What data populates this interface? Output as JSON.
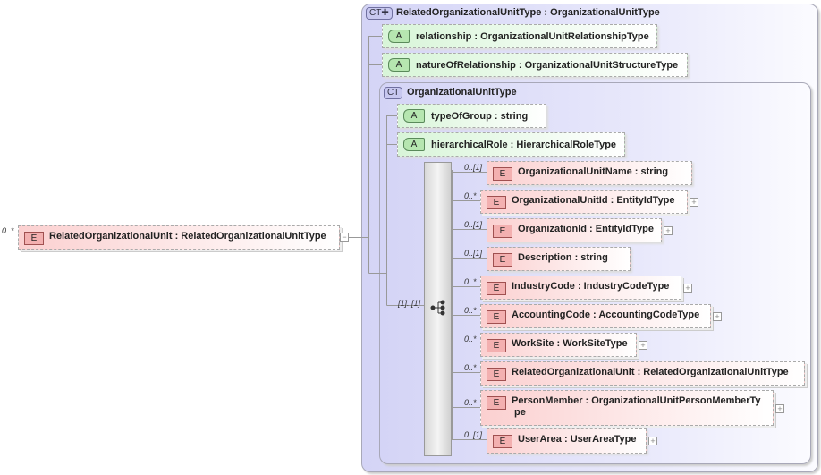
{
  "root": {
    "cardinality": "0..*",
    "badge": "E",
    "label": "RelatedOrganizationalUnit : RelatedOrganizationalUnitType",
    "toggle": "−"
  },
  "outer_type": {
    "badge": "CT✚",
    "title": "RelatedOrganizationalUnitType : OrganizationalUnitType",
    "attributes": [
      {
        "badge": "A",
        "label": "relationship : OrganizationalUnitRelationshipType"
      },
      {
        "badge": "A",
        "label": "natureOfRelationship : OrganizationalUnitStructureType"
      }
    ]
  },
  "inner_type": {
    "badge": "CT",
    "title": "OrganizationalUnitType",
    "attributes": [
      {
        "badge": "A",
        "label": "typeOfGroup : string"
      },
      {
        "badge": "A",
        "label": "hierarchicalRole : HierarchicalRoleType"
      }
    ],
    "sequence_cardinality": "[1]..[1]",
    "elements": [
      {
        "card": "0..[1]",
        "badge": "E",
        "name": "OrganizationalUnitName : string",
        "expand": false
      },
      {
        "card": "0..*",
        "badge": "E",
        "name": "OrganizationalUnitId : EntityIdType",
        "expand": true
      },
      {
        "card": "0..[1]",
        "badge": "E",
        "name": "OrganizationId : EntityIdType",
        "expand": true
      },
      {
        "card": "0..[1]",
        "badge": "E",
        "name": "Description : string",
        "expand": false
      },
      {
        "card": "0..*",
        "badge": "E",
        "name": "IndustryCode : IndustryCodeType",
        "expand": true
      },
      {
        "card": "0..*",
        "badge": "E",
        "name": "AccountingCode : AccountingCodeType",
        "expand": true
      },
      {
        "card": "0..*",
        "badge": "E",
        "name": "WorkSite : WorkSiteType",
        "expand": true
      },
      {
        "card": "0..*",
        "badge": "E",
        "name": "RelatedOrganizationalUnit : RelatedOrganizationalUnitType",
        "expand": false
      },
      {
        "card": "0..*",
        "badge": "E",
        "name": "PersonMember : OrganizationalUnitPersonMemberTy \n pe",
        "expand": true
      },
      {
        "card": "0..[1]",
        "badge": "E",
        "name": "UserArea : UserAreaType",
        "expand": true
      }
    ]
  }
}
